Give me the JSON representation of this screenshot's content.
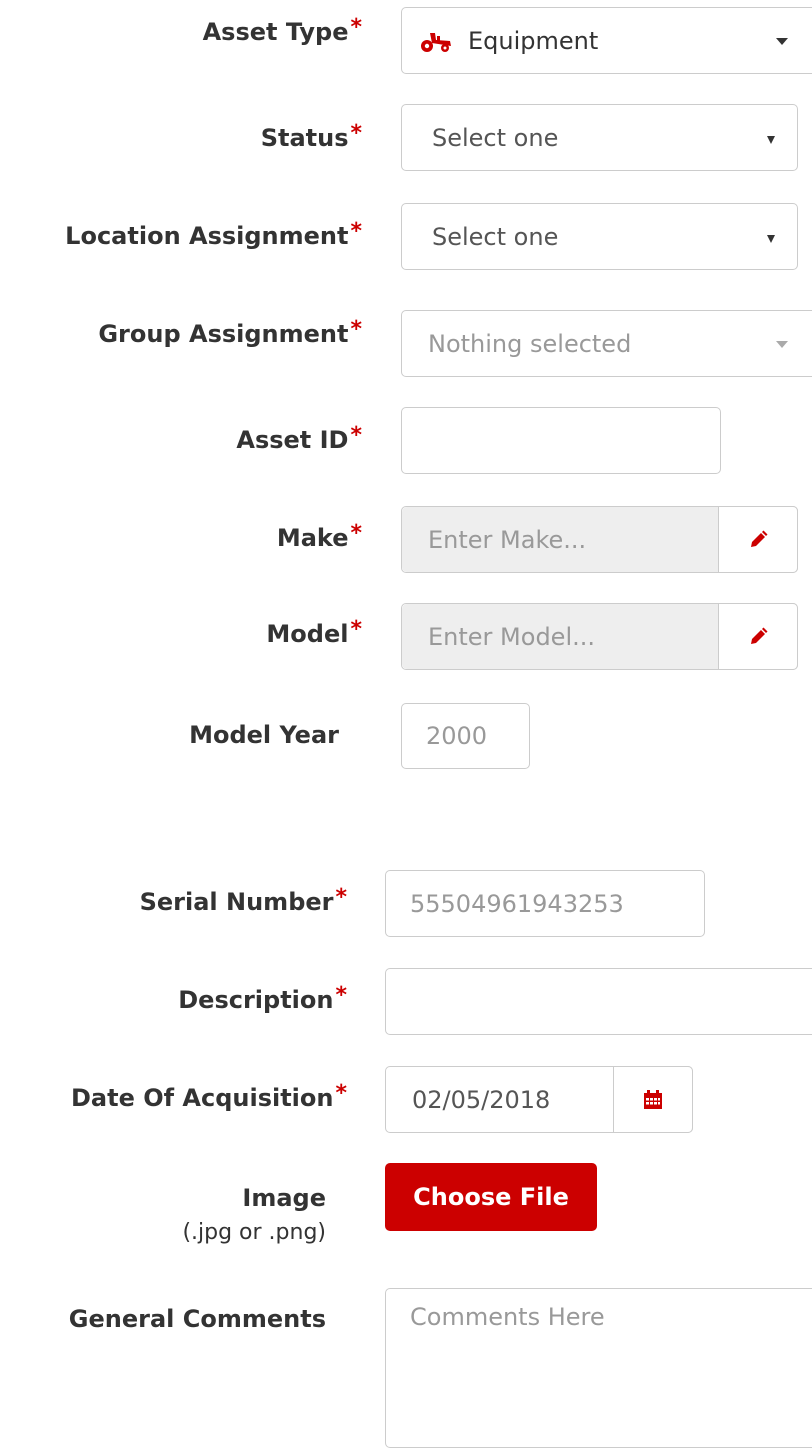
{
  "required_mark": "*",
  "accent_color": "#cc0000",
  "fields": {
    "asset_type": {
      "label": "Asset Type",
      "value": "Equipment",
      "icon": "tractor-icon"
    },
    "status": {
      "label": "Status",
      "value": "Select one"
    },
    "location": {
      "label": "Location Assignment",
      "value": "Select one"
    },
    "group": {
      "label": "Group Assignment",
      "value": "Nothing selected"
    },
    "asset_id": {
      "label": "Asset ID",
      "value": ""
    },
    "make": {
      "label": "Make",
      "placeholder": "Enter Make...",
      "icon": "pencil-icon"
    },
    "model": {
      "label": "Model",
      "placeholder": "Enter Model...",
      "icon": "pencil-icon"
    },
    "model_year": {
      "label": "Model Year",
      "placeholder": "2000"
    },
    "serial_number": {
      "label": "Serial Number",
      "placeholder": "55504961943253"
    },
    "description": {
      "label": "Description",
      "value": ""
    },
    "date_of_acquisition": {
      "label": "Date Of Acquisition",
      "value": "02/05/2018",
      "icon": "calendar-icon"
    },
    "image": {
      "label": "Image",
      "sublabel": "(.jpg or .png)",
      "button_label": "Choose File"
    },
    "general_comments": {
      "label": "General Comments",
      "placeholder": "Comments Here"
    }
  }
}
